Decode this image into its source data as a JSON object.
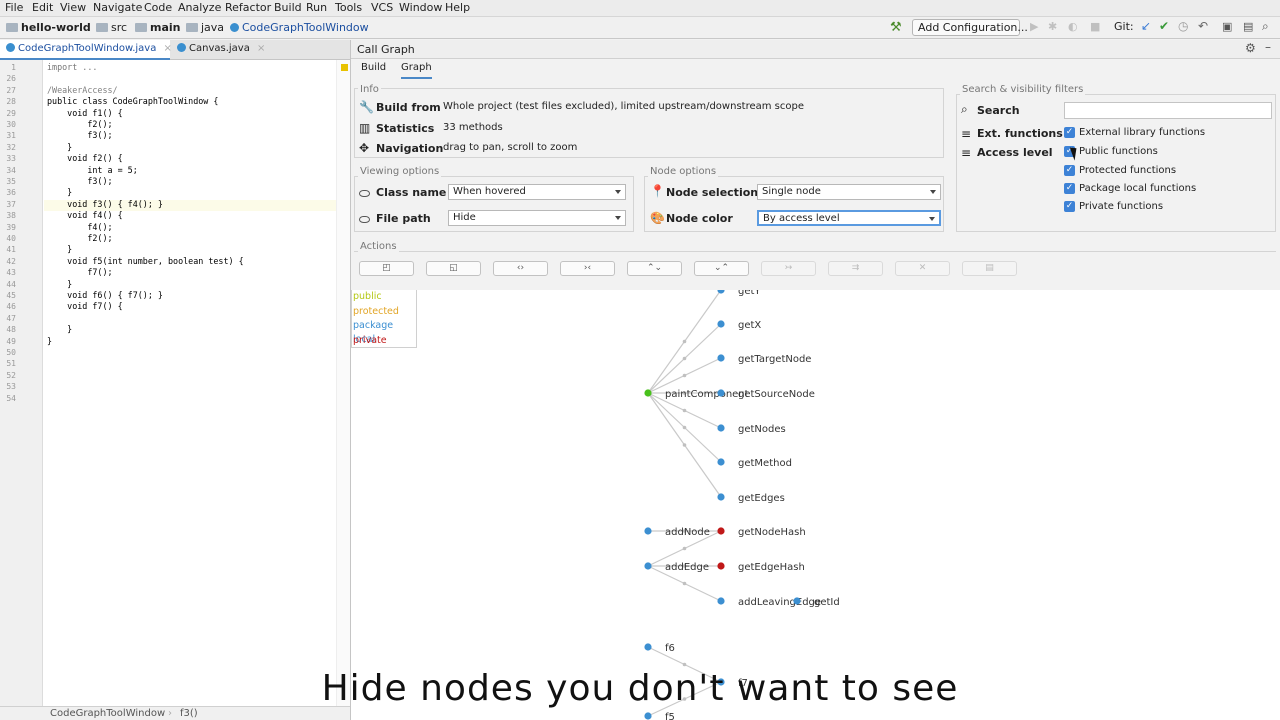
{
  "menu": [
    "File",
    "Edit",
    "View",
    "Navigate",
    "Code",
    "Analyze",
    "Refactor",
    "Build",
    "Run",
    "Tools",
    "VCS",
    "Window",
    "Help"
  ],
  "breadcrumbs": [
    "hello-world",
    "src",
    "main",
    "java",
    "CodeGraphToolWindow"
  ],
  "toolbar": {
    "config_label": "Add Configuration...",
    "git_label": "Git:"
  },
  "editor_tabs": [
    {
      "label": "CodeGraphToolWindow.java",
      "active": true
    },
    {
      "label": "Canvas.java",
      "active": false
    }
  ],
  "code": {
    "line_numbers": [
      "1",
      "26",
      "27",
      "28",
      "29",
      "30",
      "31",
      "32",
      "33",
      "34",
      "35",
      "36",
      "37",
      "38",
      "39",
      "40",
      "41",
      "42",
      "43",
      "44",
      "45",
      "46",
      "47",
      "48",
      "49",
      "50",
      "51",
      "52",
      "53",
      "54"
    ],
    "lines": [
      "import ...",
      "",
      "/WeakerAccess/",
      "public class CodeGraphToolWindow {",
      "    void f1() {",
      "        f2();",
      "        f3();",
      "    }",
      "    void f2() {",
      "        int a = 5;",
      "        f3();",
      "    }",
      "    void f3() { f4(); }",
      "    void f4() {",
      "        f4();",
      "        f2();",
      "    }",
      "    void f5(int number, boolean test) {",
      "        f7();",
      "    }",
      "    void f6() { f7(); }",
      "    void f7() {",
      "",
      "    }",
      "}",
      "",
      "",
      "",
      "",
      ""
    ]
  },
  "status_bar": {
    "class": "CodeGraphToolWindow",
    "method": "f3()"
  },
  "panel": {
    "title": "Call Graph",
    "tabs": [
      "Build",
      "Graph"
    ],
    "active_tab": "Graph",
    "info": {
      "title": "Info",
      "build_from_label": "Build from",
      "build_from_value": "Whole project (test files excluded), limited upstream/downstream scope",
      "statistics_label": "Statistics",
      "statistics_value": "33 methods",
      "navigation_label": "Navigation",
      "navigation_value": "drag to pan, scroll to zoom"
    },
    "viewing": {
      "title": "Viewing options",
      "class_name_label": "Class name",
      "class_name_value": "When hovered",
      "file_path_label": "File path",
      "file_path_value": "Hide"
    },
    "node_options": {
      "title": "Node options",
      "node_selection_label": "Node selection",
      "node_selection_value": "Single node",
      "node_color_label": "Node color",
      "node_color_value": "By access level"
    },
    "filters": {
      "title": "Search & visibility filters",
      "search_label": "Search",
      "search_value": "",
      "ext_functions_label": "Ext. functions",
      "access_level_label": "Access level",
      "checkboxes": [
        {
          "label": "External library functions",
          "checked": true
        },
        {
          "label": "Public functions",
          "checked": true
        },
        {
          "label": "Protected functions",
          "checked": true
        },
        {
          "label": "Package local functions",
          "checked": true
        },
        {
          "label": "Private functions",
          "checked": true
        }
      ]
    },
    "actions": {
      "title": "Actions",
      "buttons": [
        "◰",
        "◱",
        "‹›",
        "›‹",
        "⌃⌄",
        "⌄⌃",
        "↣",
        "⇉",
        "✕",
        "▤"
      ]
    },
    "legend": [
      {
        "label": "public",
        "color": "#b4c814"
      },
      {
        "label": "protected",
        "color": "#e2a526"
      },
      {
        "label": "package local",
        "color": "#3c8fd1"
      },
      {
        "label": "private",
        "color": "#c01818"
      }
    ]
  },
  "graph": {
    "nodes": [
      {
        "id": "getY",
        "label": "getY",
        "access": "package"
      },
      {
        "id": "getX",
        "label": "getX",
        "access": "package"
      },
      {
        "id": "getTargetNode",
        "label": "getTargetNode",
        "access": "package"
      },
      {
        "id": "paintComponent",
        "label": "paintComponent",
        "access": "public"
      },
      {
        "id": "getSourceNode",
        "label": "getSourceNode",
        "access": "package"
      },
      {
        "id": "getNodes",
        "label": "getNodes",
        "access": "package"
      },
      {
        "id": "getMethod",
        "label": "getMethod",
        "access": "package"
      },
      {
        "id": "getEdges",
        "label": "getEdges",
        "access": "package"
      },
      {
        "id": "addNode",
        "label": "addNode",
        "access": "package"
      },
      {
        "id": "getNodeHash",
        "label": "getNodeHash",
        "access": "private"
      },
      {
        "id": "addEdge",
        "label": "addEdge",
        "access": "package"
      },
      {
        "id": "getEdgeHash",
        "label": "getEdgeHash",
        "access": "private"
      },
      {
        "id": "addLeavingEdge",
        "label": "addLeavingEdge",
        "access": "package"
      },
      {
        "id": "getId",
        "label": "getId",
        "access": "package"
      },
      {
        "id": "f6",
        "label": "f6",
        "access": "package"
      },
      {
        "id": "f7",
        "label": "f7",
        "access": "package"
      },
      {
        "id": "f5",
        "label": "f5",
        "access": "package"
      }
    ],
    "edges": [
      [
        "paintComponent",
        "getY"
      ],
      [
        "paintComponent",
        "getX"
      ],
      [
        "paintComponent",
        "getTargetNode"
      ],
      [
        "paintComponent",
        "getSourceNode"
      ],
      [
        "paintComponent",
        "getNodes"
      ],
      [
        "paintComponent",
        "getMethod"
      ],
      [
        "paintComponent",
        "getEdges"
      ],
      [
        "addNode",
        "getNodeHash"
      ],
      [
        "addEdge",
        "getNodeHash"
      ],
      [
        "addEdge",
        "getEdgeHash"
      ],
      [
        "addEdge",
        "addLeavingEdge"
      ],
      [
        "f6",
        "f7"
      ],
      [
        "f5",
        "f7"
      ]
    ]
  },
  "caption": "Hide nodes you don't want to see",
  "colors": {
    "public": "#49c11c",
    "package": "#3c8fd1",
    "private": "#c01818",
    "accent": "#3d82d6"
  }
}
